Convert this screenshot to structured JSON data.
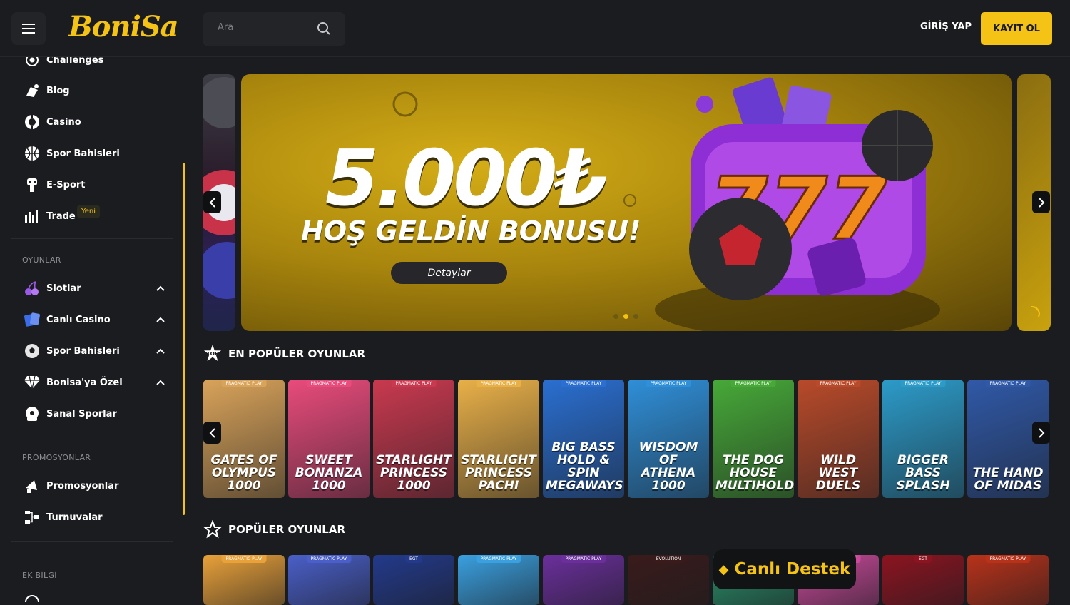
{
  "header": {
    "logo": "BoniSa",
    "search_placeholder": "Ara",
    "login_label": "GİRİŞ YAP",
    "register_label": "KAYIT OL",
    "accent_color": "#f5c315"
  },
  "sidebar": {
    "top_items": [
      {
        "label": "Challenges",
        "icon": "target-icon"
      },
      {
        "label": "Blog",
        "icon": "blog-icon"
      },
      {
        "label": "Casino",
        "icon": "casino-chip-icon"
      },
      {
        "label": "Spor Bahisleri",
        "icon": "basketball-icon"
      },
      {
        "label": "E-Sport",
        "icon": "esport-icon"
      },
      {
        "label": "Trade",
        "icon": "trade-chart-icon",
        "badge": "Yeni"
      }
    ],
    "games_header": "OYUNLAR",
    "game_items": [
      {
        "label": "Slotlar",
        "icon": "cherry-icon"
      },
      {
        "label": "Canlı Casino",
        "icon": "cards-icon"
      },
      {
        "label": "Spor Bahisleri",
        "icon": "soccer-ball-icon"
      },
      {
        "label": "Bonisa'ya Özel",
        "icon": "diamond-icon"
      },
      {
        "label": "Sanal Sporlar",
        "icon": "virtual-sports-icon"
      }
    ],
    "promo_header": "PROMOSYONLAR",
    "promo_items": [
      {
        "label": "Promosyonlar",
        "icon": "megaphone-icon"
      },
      {
        "label": "Turnuvalar",
        "icon": "tournament-icon"
      }
    ],
    "info_header": "EK BİLGİ"
  },
  "banner": {
    "amount": "5.000₺",
    "subtitle": "HOŞ GELDİN BONUSU!",
    "button": "Detaylar",
    "active_slide": 2,
    "slide_count": 3
  },
  "sections": {
    "top_title": "EN POPÜLER OYUNLAR",
    "top_icon_text": "TOP",
    "popular_title": "POPÜLER OYUNLAR"
  },
  "top_games": [
    {
      "provider": "PRAGMATIC PLAY",
      "title": "GATES OF OLYMPUS 1000",
      "bg": "#d9a35a"
    },
    {
      "provider": "PRAGMATIC PLAY",
      "title": "SWEET BONANZA 1000",
      "bg": "#e94b7c"
    },
    {
      "provider": "PRAGMATIC PLAY",
      "title": "STARLIGHT PRINCESS 1000",
      "bg": "#c9394f"
    },
    {
      "provider": "PRAGMATIC PLAY",
      "title": "STARLIGHT PRINCESS PACHI",
      "bg": "#e9b048"
    },
    {
      "provider": "PRAGMATIC PLAY",
      "title": "BIG BASS HOLD & SPIN MEGAWAYS",
      "bg": "#2a6fd1"
    },
    {
      "provider": "PRAGMATIC PLAY",
      "title": "WISDOM OF ATHENA 1000",
      "bg": "#2f8fd8"
    },
    {
      "provider": "PRAGMATIC PLAY",
      "title": "THE DOG HOUSE MULTIHOLD",
      "bg": "#47a938"
    },
    {
      "provider": "PRAGMATIC PLAY",
      "title": "WILD WEST DUELS",
      "bg": "#b94a2a"
    },
    {
      "provider": "PRAGMATIC PLAY",
      "title": "BIGGER BASS SPLASH",
      "bg": "#2c9bc9"
    },
    {
      "provider": "PRAGMATIC PLAY",
      "title": "THE HAND OF MIDAS",
      "bg": "#3059a8"
    }
  ],
  "popular_games": [
    {
      "provider": "PRAGMATIC PLAY",
      "bg": "#e9a13a"
    },
    {
      "provider": "PRAGMATIC PLAY",
      "bg": "#4a5fc9"
    },
    {
      "provider": "EGT",
      "bg": "#233a8c"
    },
    {
      "provider": "PRAGMATIC PLAY",
      "bg": "#3aa0e0"
    },
    {
      "provider": "PRAGMATIC PLAY",
      "bg": "#6b2f9c"
    },
    {
      "provider": "EVOLUTION",
      "bg": "#3a1b1b"
    },
    {
      "provider": "",
      "bg": "#2a8f6a"
    },
    {
      "provider": "PRAGMATIC PLAY",
      "bg": "#c94a9a"
    },
    {
      "provider": "EGT",
      "bg": "#8c1420"
    },
    {
      "provider": "PRAGMATIC PLAY",
      "bg": "#b8321a"
    }
  ],
  "live_support": "Canlı Destek"
}
